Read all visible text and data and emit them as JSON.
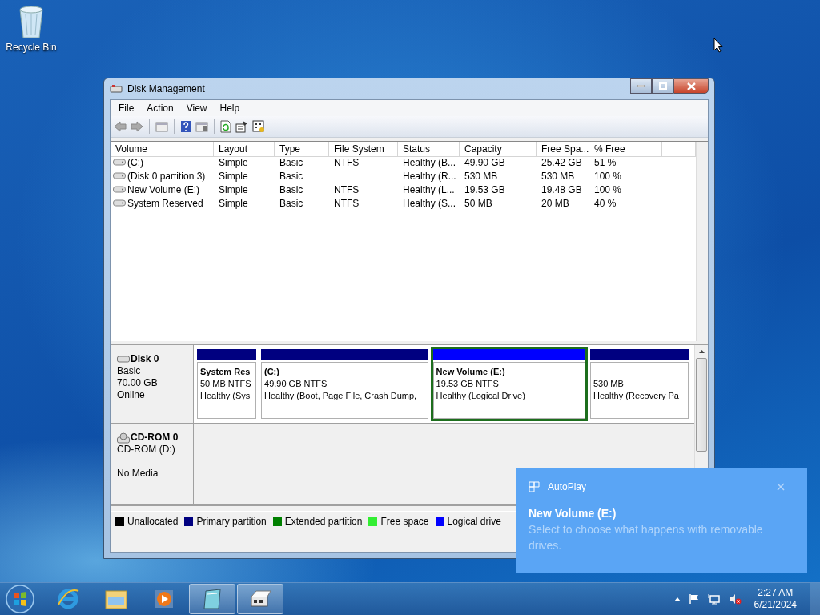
{
  "desktop": {
    "icons": [
      {
        "label": "Recycle Bin"
      }
    ]
  },
  "window": {
    "title": "Disk Management"
  },
  "menu": [
    "File",
    "Action",
    "View",
    "Help"
  ],
  "volume_table": {
    "columns": [
      "Volume",
      "Layout",
      "Type",
      "File System",
      "Status",
      "Capacity",
      "Free Spa...",
      "% Free"
    ],
    "rows": [
      [
        "(C:)",
        "Simple",
        "Basic",
        "NTFS",
        "Healthy (B...",
        "49.90 GB",
        "25.42 GB",
        "51 %"
      ],
      [
        "(Disk 0 partition 3)",
        "Simple",
        "Basic",
        "",
        "Healthy (R...",
        "530 MB",
        "530 MB",
        "100 %"
      ],
      [
        "New Volume (E:)",
        "Simple",
        "Basic",
        "NTFS",
        "Healthy (L...",
        "19.53 GB",
        "19.48 GB",
        "100 %"
      ],
      [
        "System Reserved",
        "Simple",
        "Basic",
        "NTFS",
        "Healthy (S...",
        "50 MB",
        "20 MB",
        "40 %"
      ]
    ]
  },
  "disks": [
    {
      "kind": "disk",
      "name": "Disk 0",
      "details": [
        "Basic",
        "70.00 GB"
      ],
      "status": "Online",
      "partitions": [
        {
          "name": "System Res",
          "size": "50 MB NTFS",
          "health": "Healthy (Sys",
          "color": "#000080",
          "selected": false
        },
        {
          "name": "(C:)",
          "size": "49.90 GB NTFS",
          "health": "Healthy (Boot, Page File, Crash Dump,",
          "color": "#000080",
          "selected": false
        },
        {
          "name": "New Volume  (E:)",
          "size": "19.53 GB NTFS",
          "health": "Healthy (Logical Drive)",
          "color": "#0000ff",
          "selected": true
        },
        {
          "size": "530 MB",
          "health": "Healthy (Recovery Pa",
          "color": "#000080",
          "selected": false
        }
      ]
    },
    {
      "kind": "cdrom",
      "name": "CD-ROM 0",
      "details": [
        "CD-ROM (D:)"
      ],
      "status": "No Media"
    }
  ],
  "legend": [
    {
      "label": "Unallocated",
      "color": "#000000"
    },
    {
      "label": "Primary partition",
      "color": "#000080"
    },
    {
      "label": "Extended partition",
      "color": "#008000"
    },
    {
      "label": "Free space",
      "color": "#33ee33"
    },
    {
      "label": "Logical drive",
      "color": "#0000ff"
    }
  ],
  "notification": {
    "app": "AutoPlay",
    "title": "New Volume (E:)",
    "body": "Select to choose what happens with removable drives."
  },
  "clock": {
    "time": "2:27 AM",
    "date": "6/21/2024"
  }
}
